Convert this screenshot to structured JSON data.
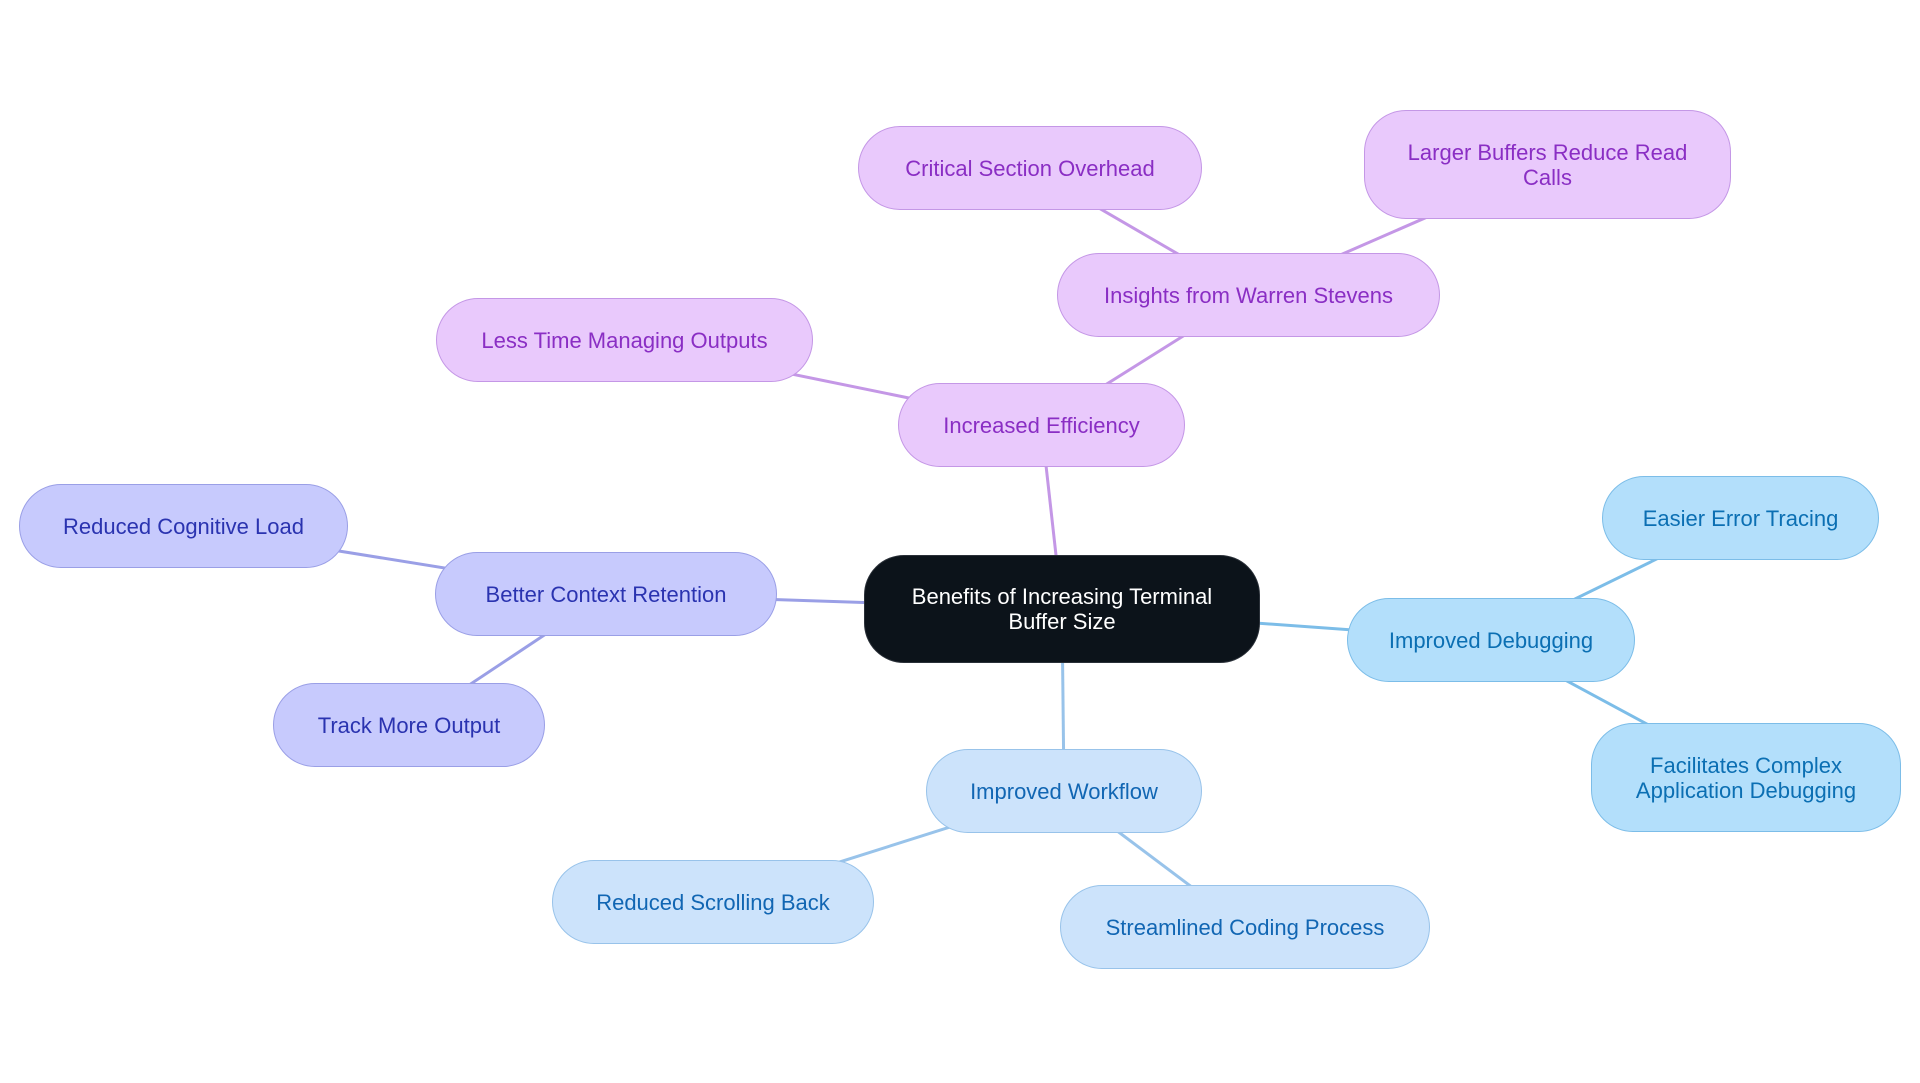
{
  "diagram": {
    "type": "mindmap",
    "root": {
      "id": "root",
      "label": "Benefits of Increasing Terminal Buffer Size"
    },
    "colors": {
      "root_fill": "#0c131a",
      "purple_fill": "#e9c9fc",
      "purple_text": "#8a2ec4",
      "purple_edge": "#c497e6",
      "indigo_fill": "#c7cafd",
      "indigo_text": "#2a33b0",
      "indigo_edge": "#9a9fe6",
      "sky_fill": "#b3dffb",
      "sky_text": "#0b6fb3",
      "sky_edge": "#7cbde8",
      "lightblue_fill": "#cce3fb",
      "lightblue_text": "#1166b3",
      "lightblue_edge": "#98c3ea"
    },
    "nodes": [
      {
        "id": "eff",
        "label": "Increased Efficiency",
        "parent": "root",
        "theme": "purple"
      },
      {
        "id": "warren",
        "label": "Insights from Warren Stevens",
        "parent": "eff",
        "theme": "purple"
      },
      {
        "id": "critical",
        "label": "Critical Section Overhead",
        "parent": "warren",
        "theme": "purple"
      },
      {
        "id": "larger",
        "label": "Larger Buffers Reduce Read Calls",
        "parent": "warren",
        "theme": "purple"
      },
      {
        "id": "lesstime",
        "label": "Less Time Managing Outputs",
        "parent": "eff",
        "theme": "purple"
      },
      {
        "id": "context",
        "label": "Better Context Retention",
        "parent": "root",
        "theme": "indigo"
      },
      {
        "id": "cognitive",
        "label": "Reduced Cognitive Load",
        "parent": "context",
        "theme": "indigo"
      },
      {
        "id": "track",
        "label": "Track More Output",
        "parent": "context",
        "theme": "indigo"
      },
      {
        "id": "debug",
        "label": "Improved Debugging",
        "parent": "root",
        "theme": "sky"
      },
      {
        "id": "error",
        "label": "Easier Error Tracing",
        "parent": "debug",
        "theme": "sky"
      },
      {
        "id": "complex",
        "label": "Facilitates Complex Application Debugging",
        "parent": "debug",
        "theme": "sky"
      },
      {
        "id": "workflow",
        "label": "Improved Workflow",
        "parent": "root",
        "theme": "lightblue"
      },
      {
        "id": "scroll",
        "label": "Reduced Scrolling Back",
        "parent": "workflow",
        "theme": "lightblue"
      },
      {
        "id": "stream",
        "label": "Streamlined Coding Process",
        "parent": "workflow",
        "theme": "lightblue"
      }
    ]
  }
}
